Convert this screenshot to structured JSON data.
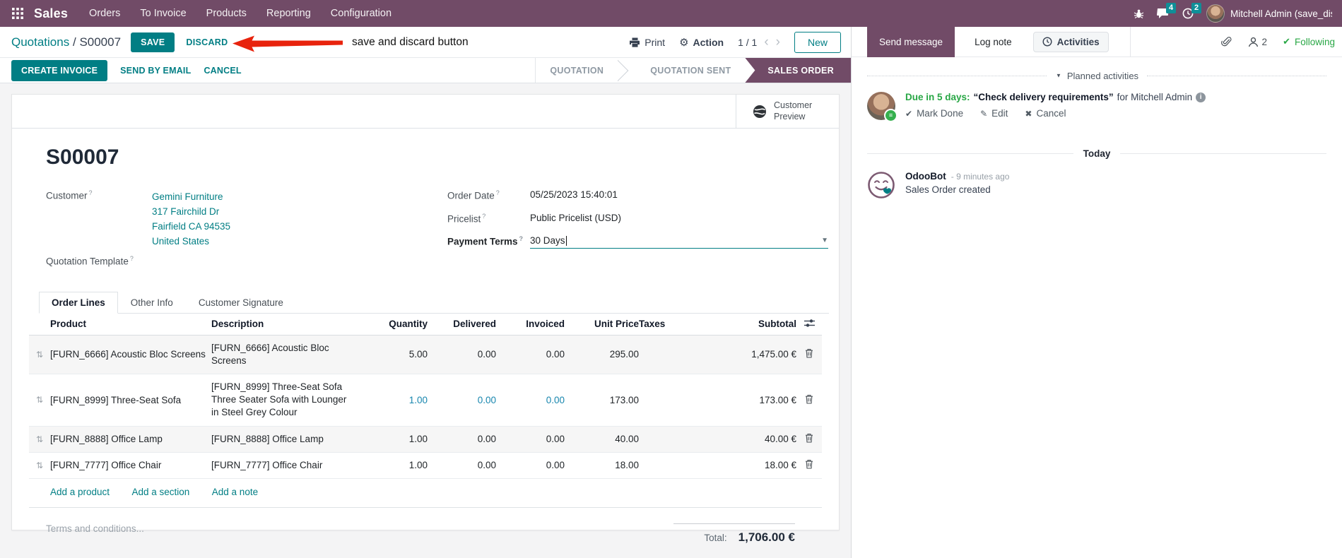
{
  "nav": {
    "app_name": "Sales",
    "items": [
      "Orders",
      "To Invoice",
      "Products",
      "Reporting",
      "Configuration"
    ],
    "message_badge": "4",
    "activity_badge": "2",
    "user_name": "Mitchell Admin (save_discar"
  },
  "control": {
    "breadcrumb_parent": "Quotations",
    "breadcrumb_sep": "/",
    "record_name": "S00007",
    "save_label": "SAVE",
    "discard_label": "DISCARD",
    "print_label": "Print",
    "action_label": "Action",
    "pager": "1 / 1",
    "pager_prev": "‹",
    "pager_next": "›",
    "new_label": "New"
  },
  "annotation": {
    "text": "save and discard button"
  },
  "actions": {
    "create_invoice": "CREATE INVOICE",
    "send_by_email": "SEND BY EMAIL",
    "cancel": "CANCEL"
  },
  "statusbar": {
    "stage1": "QUOTATION",
    "stage2": "QUOTATION SENT",
    "stage3": "SALES ORDER",
    "active": "SALES ORDER"
  },
  "sheet": {
    "customer_preview_line1": "Customer",
    "customer_preview_line2": "Preview",
    "title": "S00007",
    "fields": {
      "help_marker": "?",
      "customer_label": "Customer",
      "customer_name": "Gemini Furniture",
      "address_line1": "317 Fairchild Dr",
      "address_line2": "Fairfield CA 94535",
      "address_line3": "United States",
      "quotation_template_label": "Quotation Template",
      "order_date_label": "Order Date",
      "order_date_value": "05/25/2023 15:40:01",
      "pricelist_label": "Pricelist",
      "pricelist_value": "Public Pricelist (USD)",
      "payment_terms_label": "Payment Terms",
      "payment_terms_value": "30 Days",
      "dropdown_caret": "▼"
    },
    "tabs": {
      "order_lines": "Order Lines",
      "other_info": "Other Info",
      "customer_signature": "Customer Signature"
    },
    "table": {
      "headers": {
        "product": "Product",
        "description": "Description",
        "quantity": "Quantity",
        "delivered": "Delivered",
        "invoiced": "Invoiced",
        "unit_price": "Unit Price",
        "taxes": "Taxes",
        "subtotal": "Subtotal"
      },
      "rows": [
        {
          "product": "[FURN_6666] Acoustic Bloc Screens",
          "description": "[FURN_6666] Acoustic Bloc Screens",
          "description2": "",
          "quantity": "5.00",
          "delivered": "0.00",
          "invoiced": "0.00",
          "unit_price": "295.00",
          "taxes": "",
          "subtotal": "1,475.00 €"
        },
        {
          "product": "[FURN_8999] Three-Seat Sofa",
          "description": "[FURN_8999] Three-Seat Sofa",
          "description2": "Three Seater Sofa with Lounger in Steel Grey Colour",
          "quantity": "1.00",
          "delivered": "0.00",
          "invoiced": "0.00",
          "unit_price": "173.00",
          "taxes": "",
          "subtotal": "173.00 €"
        },
        {
          "product": "[FURN_8888] Office Lamp",
          "description": "[FURN_8888] Office Lamp",
          "description2": "",
          "quantity": "1.00",
          "delivered": "0.00",
          "invoiced": "0.00",
          "unit_price": "40.00",
          "taxes": "",
          "subtotal": "40.00 €"
        },
        {
          "product": "[FURN_7777] Office Chair",
          "description": "[FURN_7777] Office Chair",
          "description2": "",
          "quantity": "1.00",
          "delivered": "0.00",
          "invoiced": "0.00",
          "unit_price": "18.00",
          "taxes": "",
          "subtotal": "18.00 €"
        }
      ],
      "add_product": "Add a product",
      "add_section": "Add a section",
      "add_note": "Add a note",
      "drag_handle_glyph": "⇅"
    },
    "terms_placeholder": "Terms and conditions...",
    "total_label": "Total:",
    "total_value": "1,706.00 €"
  },
  "chatter": {
    "send_message": "Send message",
    "log_note": "Log note",
    "activities": "Activities",
    "followers_count": "2",
    "following": "Following",
    "following_check": "✔",
    "planned_header": "Planned activities",
    "planned_caret": "▼",
    "activity": {
      "due": "Due in 5 days:",
      "title": "“Check delivery requirements”",
      "assignee": "for Mitchell Admin",
      "info_glyph": "i",
      "mark_done": "Mark Done",
      "mark_done_glyph": "✔",
      "edit": "Edit",
      "edit_glyph": "✎",
      "cancel": "Cancel",
      "cancel_glyph": "✖",
      "badge_glyph": "≡"
    },
    "today": "Today",
    "message": {
      "author": "OdooBot",
      "time": "- 9 minutes ago",
      "body": "Sales Order created"
    }
  },
  "colors": {
    "brand_purple": "#714B67",
    "accent_teal": "#017E84",
    "badge_teal": "#0f8f98",
    "success_green": "#28a745",
    "arrow_red": "#e8230d",
    "edited_value_blue": "#1786ae"
  }
}
